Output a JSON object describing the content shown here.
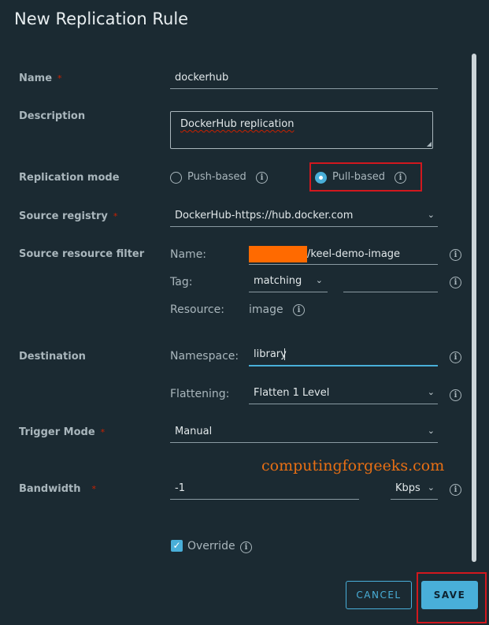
{
  "dialog": {
    "title": "New Replication Rule"
  },
  "form": {
    "name": {
      "label": "Name",
      "required": "*",
      "value": "dockerhub"
    },
    "description": {
      "label": "Description",
      "value": "DockerHub replication"
    },
    "replication_mode": {
      "label": "Replication mode",
      "options": [
        "Push-based",
        "Pull-based"
      ],
      "selected": "Pull-based"
    },
    "source_registry": {
      "label": "Source registry",
      "required": "*",
      "value": "DockerHub-https://hub.docker.com"
    },
    "source_filter": {
      "label": "Source resource filter",
      "name_label": "Name:",
      "name_value": "/keel-demo-image",
      "tag_label": "Tag:",
      "tag_mode": "matching",
      "tag_value": "",
      "resource_label": "Resource:",
      "resource_value": "image"
    },
    "destination": {
      "label": "Destination",
      "namespace_label": "Namespace:",
      "namespace_value": "library",
      "flattening_label": "Flattening:",
      "flattening_value": "Flatten 1 Level"
    },
    "trigger_mode": {
      "label": "Trigger Mode",
      "required": "*",
      "value": "Manual"
    },
    "bandwidth": {
      "label": "Bandwidth",
      "required": "*",
      "value": "-1",
      "unit": "Kbps"
    },
    "override": {
      "label": "Override",
      "checked": true
    }
  },
  "buttons": {
    "cancel": "CANCEL",
    "save": "SAVE"
  },
  "watermark": "computingforgeeks.com",
  "icons": {
    "info": "info-circle-icon",
    "chevron": "chevron-down-icon",
    "check": "checkmark-icon"
  },
  "colors": {
    "background": "#1b2a32",
    "accent": "#49afd9",
    "highlight_box": "#d1181e",
    "redaction": "#ff6a00",
    "watermark": "#e86f14"
  }
}
